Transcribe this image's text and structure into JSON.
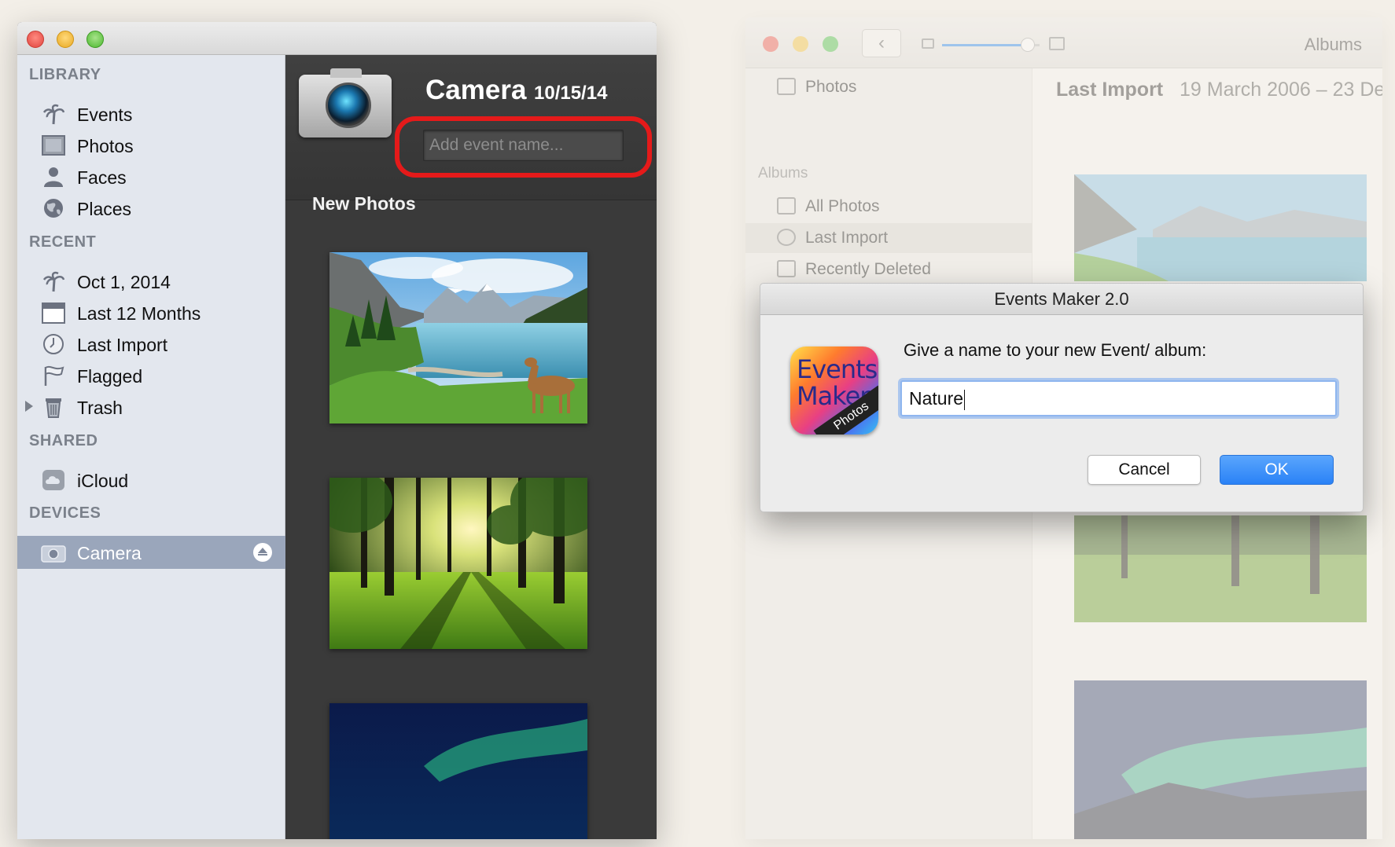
{
  "iphoto": {
    "sections": {
      "library": "LIBRARY",
      "recent": "RECENT",
      "shared": "SHARED",
      "devices": "DEVICES"
    },
    "library_items": [
      {
        "label": "Events",
        "icon": "palm-tree-icon"
      },
      {
        "label": "Photos",
        "icon": "photo-frame-icon"
      },
      {
        "label": "Faces",
        "icon": "person-icon"
      },
      {
        "label": "Places",
        "icon": "globe-icon"
      }
    ],
    "recent_items": [
      {
        "label": "Oct 1, 2014",
        "icon": "palm-tree-icon"
      },
      {
        "label": "Last 12 Months",
        "icon": "calendar-icon"
      },
      {
        "label": "Last Import",
        "icon": "clock-icon"
      },
      {
        "label": "Flagged",
        "icon": "flag-icon"
      },
      {
        "label": "Trash",
        "icon": "trash-icon"
      }
    ],
    "shared_items": [
      {
        "label": "iCloud",
        "icon": "cloud-icon"
      }
    ],
    "device_items": [
      {
        "label": "Camera",
        "icon": "camera-icon",
        "selected": true
      }
    ],
    "import": {
      "title": "Camera",
      "date": "10/15/14",
      "event_placeholder": "Add event name...",
      "new_photos_label": "New Photos"
    },
    "highlight_color": "#e51a1a"
  },
  "photos_app": {
    "toolbar_title": "Albums",
    "sidebar_top": "Photos",
    "albums_header": "Albums",
    "albums": [
      {
        "label": "All Photos"
      },
      {
        "label": "Last Import",
        "selected": true
      },
      {
        "label": "Recently Deleted"
      }
    ],
    "content_title": "Last Import",
    "content_range": "19 March 2006 – 23 De"
  },
  "dialog": {
    "title": "Events Maker 2.0",
    "app_icon_line1": "Events",
    "app_icon_line2": "Maker",
    "app_icon_ribbon": "Photos",
    "prompt": "Give a name to your new Event/ album:",
    "input_value": "Nature",
    "cancel_label": "Cancel",
    "ok_label": "OK",
    "accent_color": "#2a82f6"
  }
}
